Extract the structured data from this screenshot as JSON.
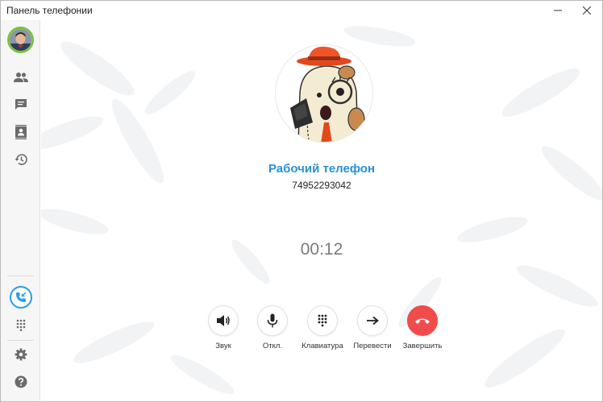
{
  "window": {
    "title": "Панель телефонии"
  },
  "contact": {
    "name": "Рабочий телефон",
    "number": "74952293042"
  },
  "call": {
    "duration": "00:12"
  },
  "actions": {
    "sound": "Звук",
    "mute": "Откл.",
    "keypad": "Клавиатура",
    "transfer": "Перевести",
    "end": "Завершить"
  },
  "colors": {
    "accent": "#2a8fd6",
    "end_call": "#f04c4c",
    "online": "#7ac142",
    "sidebar_icon": "#6b6b6b"
  },
  "sidebar": {
    "icons": [
      "contacts-icon",
      "chat-icon",
      "address-book-icon",
      "history-icon",
      "active-call-icon",
      "dialpad-icon",
      "gear-icon",
      "help-icon"
    ]
  }
}
